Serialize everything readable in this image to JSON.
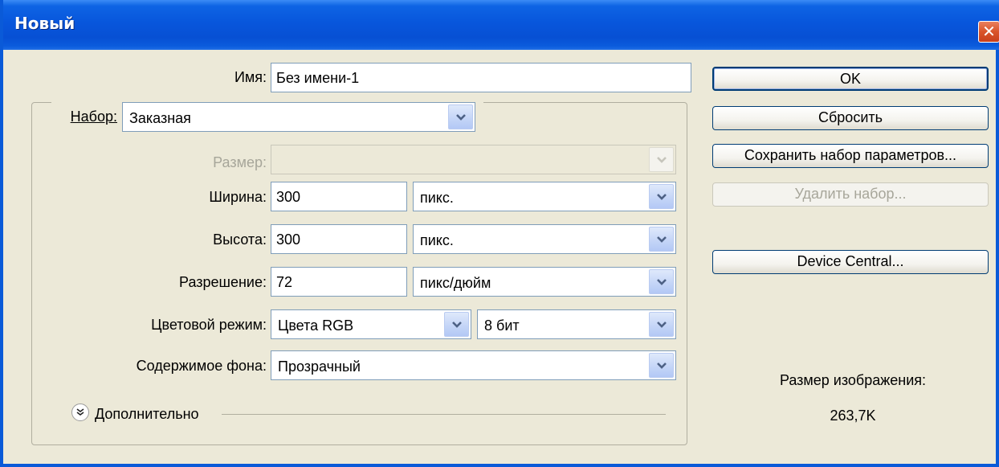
{
  "window": {
    "title": "Новый",
    "close_glyph": "✕"
  },
  "form": {
    "name": {
      "label": "Имя:",
      "value": "Без имени-1"
    },
    "preset": {
      "label": "Набор:",
      "value": "Заказная"
    },
    "size": {
      "label": "Размер:",
      "value": ""
    },
    "width": {
      "label": "Ширина:",
      "value": "300",
      "unit": "пикс."
    },
    "height": {
      "label": "Высота:",
      "value": "300",
      "unit": "пикс."
    },
    "resolution": {
      "label": "Разрешение:",
      "value": "72",
      "unit": "пикс/дюйм"
    },
    "color_mode": {
      "label": "Цветовой режим:",
      "value": "Цвета RGB",
      "depth": "8 бит"
    },
    "background": {
      "label": "Содержимое фона:",
      "value": "Прозрачный"
    },
    "advanced": {
      "label": "Дополнительно",
      "icon": "expand-chevrons-icon"
    }
  },
  "buttons": {
    "ok": "OK",
    "reset": "Сбросить",
    "save_preset": "Сохранить набор параметров...",
    "delete_preset": "Удалить набор...",
    "device_central": "Device Central..."
  },
  "info": {
    "image_size_label": "Размер изображения:",
    "image_size_value": "263,7K"
  },
  "colors": {
    "title_bar": "#0856dc",
    "face": "#ece9d8",
    "close": "#d9542a"
  }
}
